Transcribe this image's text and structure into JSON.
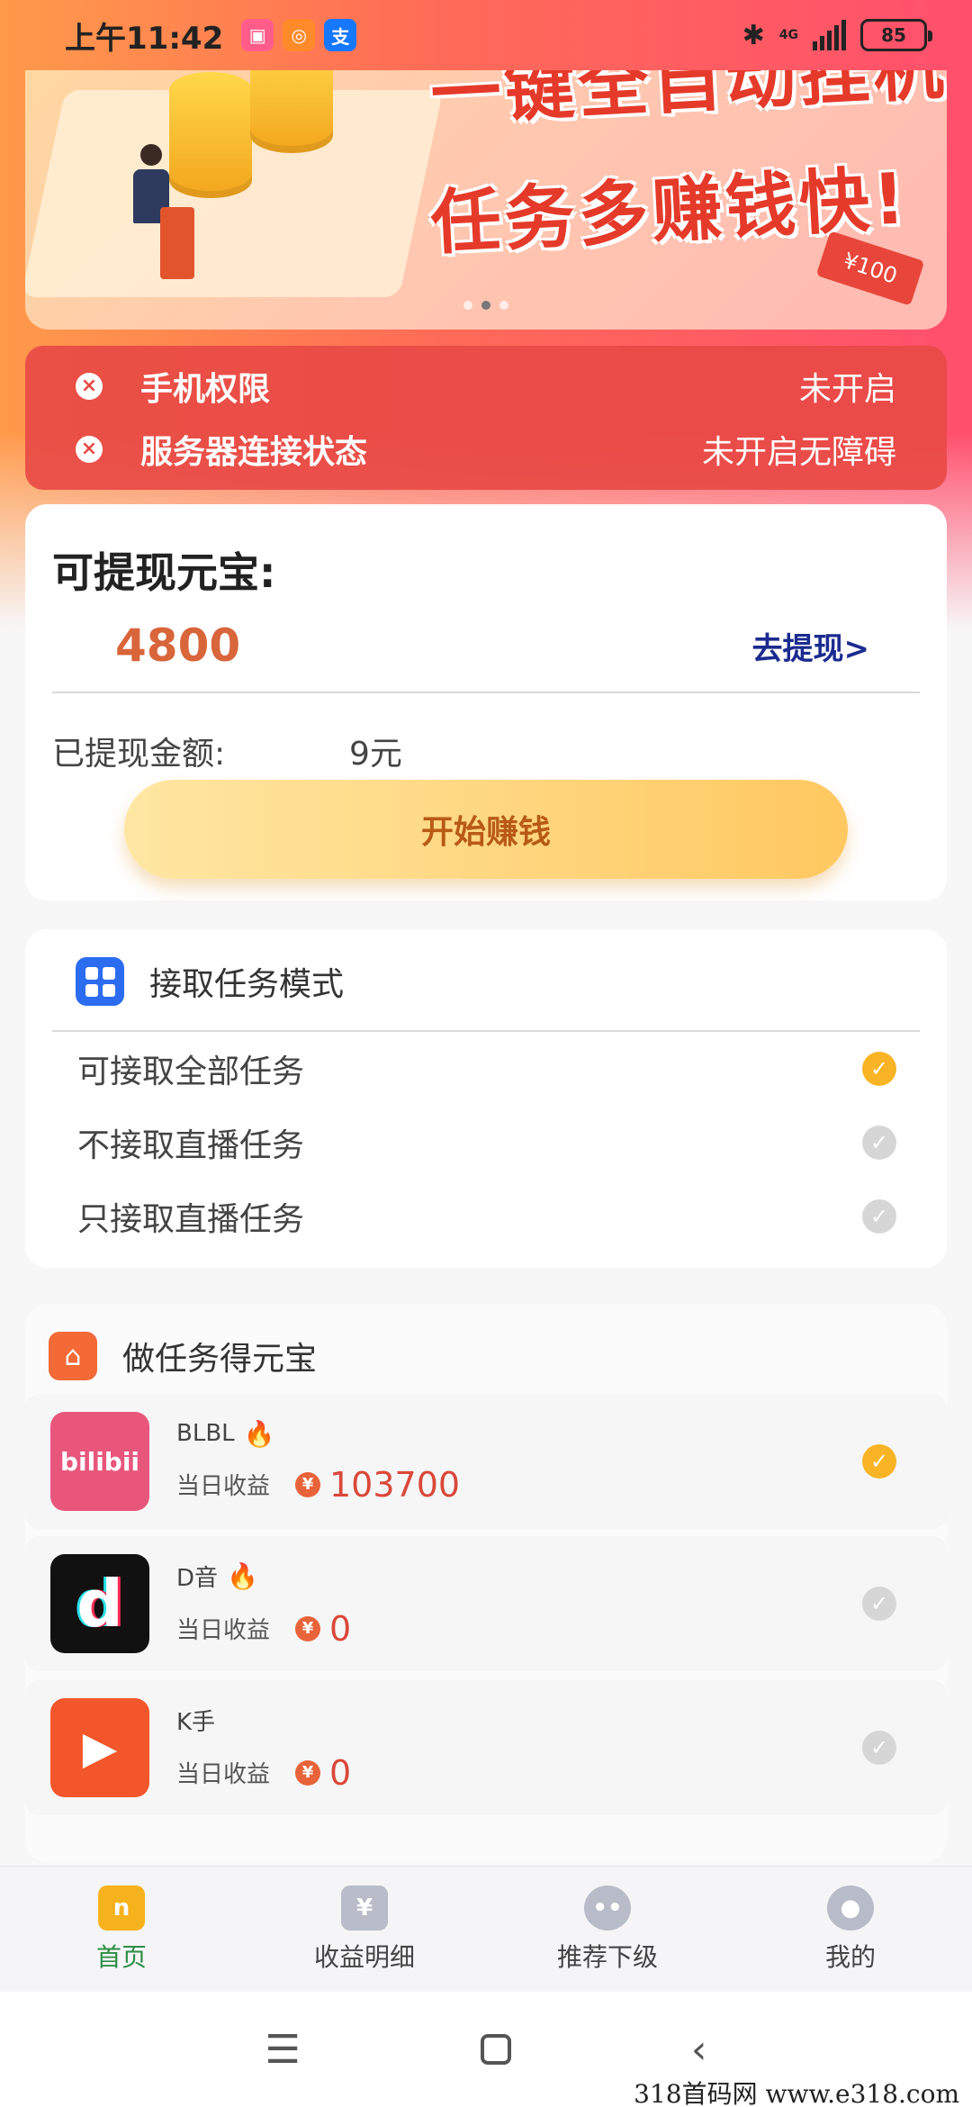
{
  "status_bar": {
    "time": "上午11:42",
    "network": "4G",
    "battery": "85",
    "app_icons": [
      "app-icon-1",
      "app-icon-2",
      "alipay-icon"
    ]
  },
  "banner": {
    "line1": "一键全自动挂机",
    "line2": "任务多赚钱快!",
    "ticket": "¥100"
  },
  "permissions": [
    {
      "label": "手机权限",
      "status": "未开启"
    },
    {
      "label": "服务器连接状态",
      "status": "未开启无障碍"
    }
  ],
  "balance": {
    "title": "可提现元宝:",
    "value": "4800",
    "withdraw_link": "去提现>",
    "withdrawn_label": "已提现金额:",
    "withdrawn_value": "9元",
    "start_button": "开始赚钱"
  },
  "task_mode": {
    "title": "接取任务模式",
    "options": [
      {
        "label": "可接取全部任务",
        "checked": true
      },
      {
        "label": "不接取直播任务",
        "checked": false
      },
      {
        "label": "只接取直播任务",
        "checked": false
      }
    ]
  },
  "earn": {
    "title": "做任务得元宝",
    "income_label": "当日收益",
    "apps": [
      {
        "name": "BLBL",
        "logo_text": "bilibii",
        "income": "103700",
        "checked": true,
        "hot": true,
        "color": "#e8567c"
      },
      {
        "name": "D音",
        "logo_text": "d",
        "income": "0",
        "checked": false,
        "hot": true,
        "color": "#111111"
      },
      {
        "name": "K手",
        "logo_text": "▶",
        "income": "0",
        "checked": false,
        "hot": false,
        "color": "#f2562a"
      }
    ]
  },
  "bottom_nav": [
    {
      "label": "首页",
      "icon": "home-icon",
      "active": true
    },
    {
      "label": "收益明细",
      "icon": "calendar-yen-icon",
      "active": false
    },
    {
      "label": "推荐下级",
      "icon": "users-icon",
      "active": false
    },
    {
      "label": "我的",
      "icon": "profile-icon",
      "active": false
    }
  ],
  "watermark": "318首码网 www.e318.com"
}
